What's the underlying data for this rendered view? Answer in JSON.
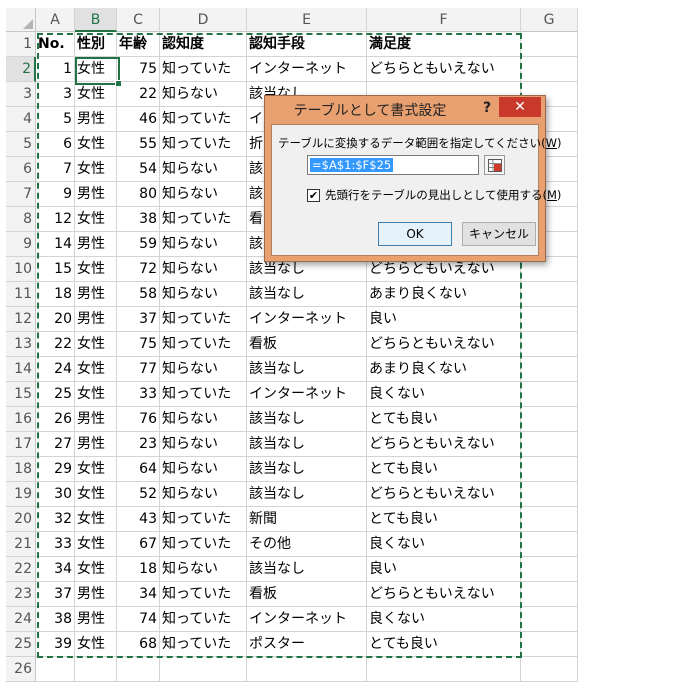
{
  "columns": [
    "A",
    "B",
    "C",
    "D",
    "E",
    "F",
    "G"
  ],
  "selected_column": "B",
  "row_numbers": [
    "1",
    "2",
    "3",
    "4",
    "5",
    "6",
    "7",
    "8",
    "9",
    "10",
    "11",
    "12",
    "13",
    "14",
    "15",
    "16",
    "17",
    "18",
    "19",
    "20",
    "21",
    "22",
    "23",
    "24",
    "25",
    "26"
  ],
  "selected_row": "2",
  "header_row": [
    "No.",
    "性別",
    "年齢",
    "認知度",
    "認知手段",
    "満足度"
  ],
  "rows": [
    [
      "1",
      "女性",
      "75",
      "知っていた",
      "インターネット",
      "どちらともいえない"
    ],
    [
      "3",
      "女性",
      "22",
      "知らない",
      "該当なし",
      ""
    ],
    [
      "5",
      "男性",
      "46",
      "知っていた",
      "イ",
      ""
    ],
    [
      "6",
      "女性",
      "55",
      "知っていた",
      "折",
      ""
    ],
    [
      "7",
      "女性",
      "54",
      "知らない",
      "該",
      ""
    ],
    [
      "9",
      "男性",
      "80",
      "知らない",
      "該",
      ""
    ],
    [
      "12",
      "女性",
      "38",
      "知っていた",
      "看",
      ""
    ],
    [
      "14",
      "男性",
      "59",
      "知らない",
      "該",
      ""
    ],
    [
      "15",
      "女性",
      "72",
      "知らない",
      "該当なし",
      "どちらともいえない"
    ],
    [
      "18",
      "男性",
      "58",
      "知らない",
      "該当なし",
      "あまり良くない"
    ],
    [
      "20",
      "男性",
      "37",
      "知っていた",
      "インターネット",
      "良い"
    ],
    [
      "22",
      "女性",
      "75",
      "知っていた",
      "看板",
      "どちらともいえない"
    ],
    [
      "24",
      "女性",
      "77",
      "知らない",
      "該当なし",
      "あまり良くない"
    ],
    [
      "25",
      "女性",
      "33",
      "知っていた",
      "インターネット",
      "良くない"
    ],
    [
      "26",
      "男性",
      "76",
      "知らない",
      "該当なし",
      "とても良い"
    ],
    [
      "27",
      "男性",
      "23",
      "知らない",
      "該当なし",
      "どちらともいえない"
    ],
    [
      "29",
      "女性",
      "64",
      "知らない",
      "該当なし",
      "とても良い"
    ],
    [
      "30",
      "女性",
      "52",
      "知らない",
      "該当なし",
      "どちらともいえない"
    ],
    [
      "32",
      "女性",
      "43",
      "知っていた",
      "新聞",
      "とても良い"
    ],
    [
      "33",
      "女性",
      "67",
      "知っていた",
      "その他",
      "良くない"
    ],
    [
      "34",
      "女性",
      "18",
      "知らない",
      "該当なし",
      "良い"
    ],
    [
      "37",
      "男性",
      "34",
      "知っていた",
      "看板",
      "どちらともいえない"
    ],
    [
      "38",
      "男性",
      "74",
      "知っていた",
      "インターネット",
      "良くない"
    ],
    [
      "39",
      "女性",
      "68",
      "知っていた",
      "ポスター",
      "とても良い"
    ]
  ],
  "dialog": {
    "title": "テーブルとして書式設定",
    "help": "?",
    "close": "✕",
    "prompt": "テーブルに変換するデータ範囲を指定してください(",
    "prompt_key": "W",
    "prompt_end": ")",
    "range_value": "=$A$1:$F$25",
    "checkbox_checked": true,
    "checkbox_mark": "✔",
    "checkbox_label": "先頭行をテーブルの見出しとして使用する(",
    "checkbox_key": "M",
    "checkbox_end": ")",
    "ok_label": "OK",
    "cancel_label": "キャンセル"
  },
  "colors": {
    "accent_green": "#217346",
    "dialog_frame": "#e8a070",
    "close_red": "#c8392c",
    "selection_blue": "#3399ff"
  }
}
